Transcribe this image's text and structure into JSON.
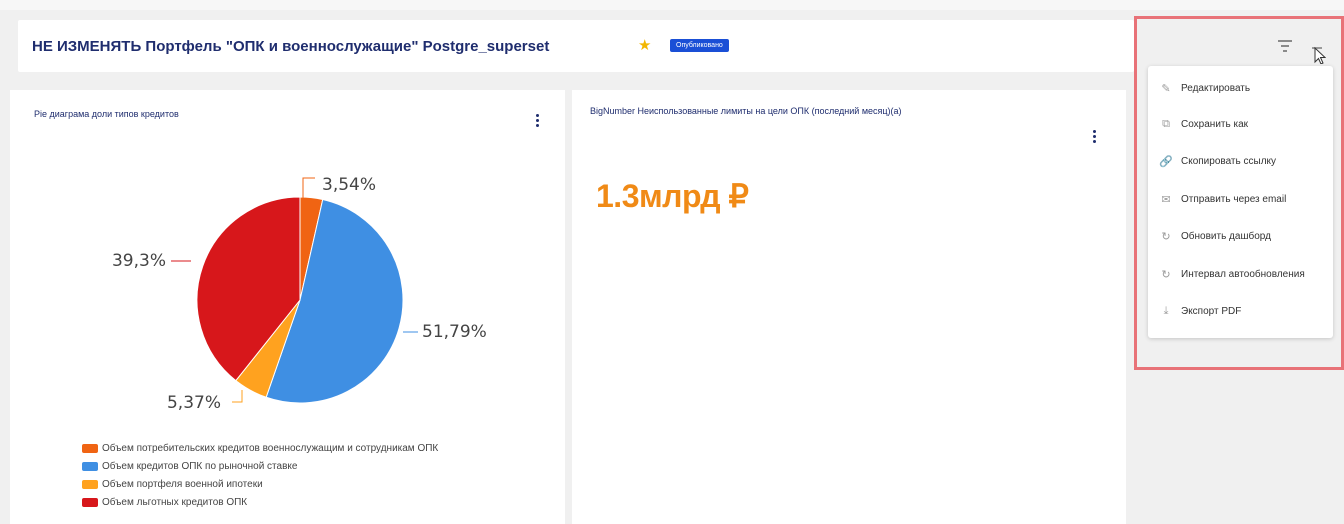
{
  "header": {
    "title": "НЕ ИЗМЕНЯТЬ Портфель \"ОПК и военнослужащие\" Postgre_superset",
    "badge": "Опубликовано"
  },
  "panels": {
    "pie": {
      "title": "Pie диаграма доли типов кредитов"
    },
    "bignumber": {
      "title": "BigNumber Неиспользованные лимиты на цели ОПК (последний месяц)(а)",
      "value": "1.3млрд ₽"
    }
  },
  "chart_data": {
    "type": "pie",
    "title": "",
    "slices": [
      {
        "label": "Объем потребительских кредитов военнослужащим и сотрудникам ОПК",
        "value": 3.54,
        "display": "3,54%",
        "color": "#f06413"
      },
      {
        "label": "Объем кредитов ОПК по рыночной ставке",
        "value": 51.79,
        "display": "51,79%",
        "color": "#3f8fe3"
      },
      {
        "label": "Объем портфеля военной ипотеки",
        "value": 5.37,
        "display": "5,37%",
        "color": "#ffa21f"
      },
      {
        "label": "Объем льготных кредитов ОПК",
        "value": 39.3,
        "display": "39,3%",
        "color": "#d7171b"
      }
    ],
    "legend_position": "bottom-left"
  },
  "menu": {
    "items": [
      {
        "label": "Редактировать",
        "icon": "pencil-icon"
      },
      {
        "label": "Сохранить как",
        "icon": "save-copy-icon"
      },
      {
        "label": "Скопировать ссылку",
        "icon": "link-icon"
      },
      {
        "label": "Отправить через email",
        "icon": "mail-icon"
      },
      {
        "label": "Обновить дашборд",
        "icon": "refresh-icon"
      },
      {
        "label": "Интервал автообновления",
        "icon": "refresh-interval-icon"
      },
      {
        "label": "Экспорт PDF",
        "icon": "download-icon"
      }
    ]
  },
  "colors": {
    "accent": "#1a4fd6",
    "bignumber": "#f08a16",
    "highlight": "#e87278"
  }
}
